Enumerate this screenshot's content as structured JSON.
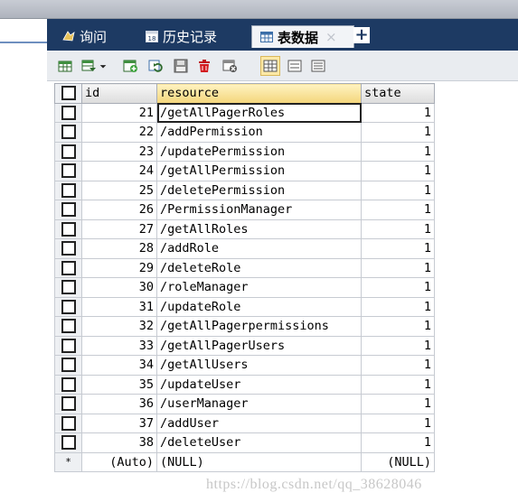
{
  "tabs": [
    {
      "label": "询问",
      "icon": "query-icon",
      "active": false
    },
    {
      "label": "历史记录",
      "icon": "history-icon",
      "active": false
    },
    {
      "label": "表数据",
      "icon": "table-icon",
      "active": true,
      "close": "×"
    }
  ],
  "add_tab": "+",
  "toolbar_icons": [
    "import-icon",
    "export-icon",
    "add-row-icon",
    "refresh-icon",
    "save-icon",
    "delete-icon",
    "cancel-icon",
    "grid-view-icon",
    "form-view-icon",
    "text-view-icon"
  ],
  "table": {
    "columns": [
      "id",
      "resource",
      "state"
    ],
    "rows": [
      {
        "id": "21",
        "resource": "/getAllPagerRoles",
        "state": "1"
      },
      {
        "id": "22",
        "resource": "/addPermission",
        "state": "1"
      },
      {
        "id": "23",
        "resource": "/updatePermission",
        "state": "1"
      },
      {
        "id": "24",
        "resource": "/getAllPermission",
        "state": "1"
      },
      {
        "id": "25",
        "resource": "/deletePermission",
        "state": "1"
      },
      {
        "id": "26",
        "resource": "/PermissionManager",
        "state": "1"
      },
      {
        "id": "27",
        "resource": "/getAllRoles",
        "state": "1"
      },
      {
        "id": "28",
        "resource": "/addRole",
        "state": "1"
      },
      {
        "id": "29",
        "resource": "/deleteRole",
        "state": "1"
      },
      {
        "id": "30",
        "resource": "/roleManager",
        "state": "1"
      },
      {
        "id": "31",
        "resource": "/updateRole",
        "state": "1"
      },
      {
        "id": "32",
        "resource": "/getAllPagerpermissions",
        "state": "1"
      },
      {
        "id": "33",
        "resource": "/getAllPagerUsers",
        "state": "1"
      },
      {
        "id": "34",
        "resource": "/getAllUsers",
        "state": "1"
      },
      {
        "id": "35",
        "resource": "/updateUser",
        "state": "1"
      },
      {
        "id": "36",
        "resource": "/userManager",
        "state": "1"
      },
      {
        "id": "37",
        "resource": "/addUser",
        "state": "1"
      },
      {
        "id": "38",
        "resource": "/deleteUser",
        "state": "1"
      }
    ],
    "new_row": {
      "marker": "*",
      "id": "(Auto)",
      "resource": "(NULL)",
      "state": "(NULL)"
    }
  },
  "watermark": "https://blog.csdn.net/qq_38628046"
}
